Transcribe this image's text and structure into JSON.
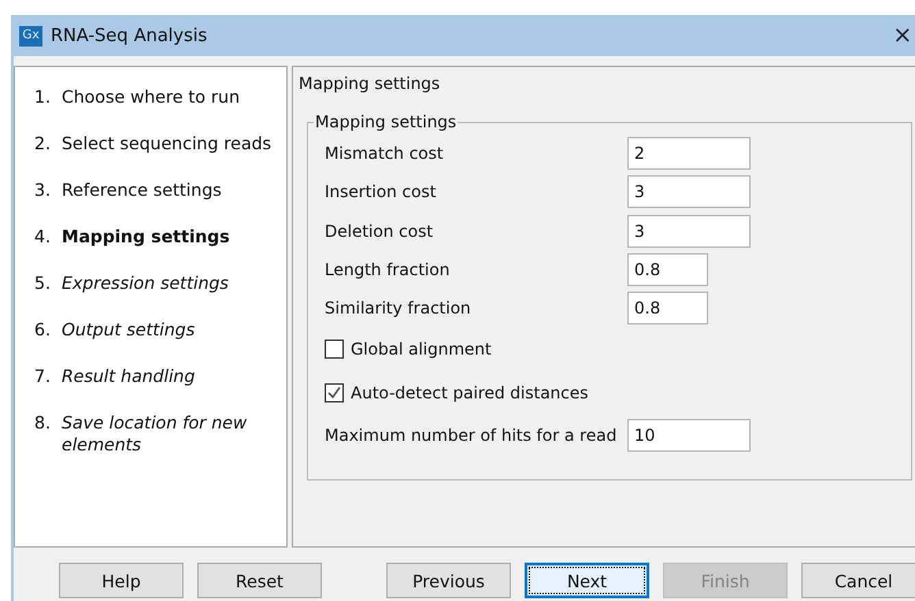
{
  "window": {
    "title": "RNA-Seq Analysis",
    "app_badge": "Gx",
    "close": "×"
  },
  "steps": [
    {
      "number": "1.",
      "label": "Choose where to run",
      "selected": false,
      "visited": true
    },
    {
      "number": "2.",
      "label": "Select sequencing reads",
      "selected": false,
      "visited": true
    },
    {
      "number": "3.",
      "label": "Reference settings",
      "selected": false,
      "visited": true
    },
    {
      "number": "4.",
      "label": "Mapping settings",
      "selected": true,
      "visited": true
    },
    {
      "number": "5.",
      "label": "Expression settings",
      "selected": false,
      "visited": false
    },
    {
      "number": "6.",
      "label": "Output settings",
      "selected": false,
      "visited": false
    },
    {
      "number": "7.",
      "label": "Result handling",
      "selected": false,
      "visited": false
    },
    {
      "number": "8.",
      "label": "Save location for new elements",
      "selected": false,
      "visited": false
    }
  ],
  "panel": {
    "title": "Mapping settings",
    "group_title": "Mapping settings",
    "rows": [
      {
        "kind": "field",
        "label": "Mismatch cost",
        "value": "2"
      },
      {
        "kind": "field",
        "label": "Insertion cost",
        "value": "3"
      },
      {
        "kind": "field",
        "label": "Deletion cost",
        "value": "3"
      },
      {
        "kind": "short-field",
        "label": "Length fraction",
        "value": "0.8"
      },
      {
        "kind": "short-field",
        "label": "Similarity fraction",
        "value": "0.8"
      },
      {
        "kind": "checkbox",
        "label": "Global alignment",
        "checked": false
      },
      {
        "kind": "checkbox",
        "label": "Auto-detect paired distances",
        "checked": true
      },
      {
        "kind": "field",
        "label": "Maximum number of hits for a read",
        "value": "10"
      }
    ]
  },
  "buttons": [
    {
      "label": "Help",
      "focused": false,
      "disabled": false
    },
    {
      "label": "Reset",
      "focused": false,
      "disabled": false
    },
    {
      "label": "Previous",
      "focused": false,
      "disabled": false
    },
    {
      "label": "Next",
      "focused": true,
      "disabled": false
    },
    {
      "label": "Finish",
      "focused": false,
      "disabled": true
    },
    {
      "label": "Cancel",
      "focused": false,
      "disabled": false
    }
  ]
}
